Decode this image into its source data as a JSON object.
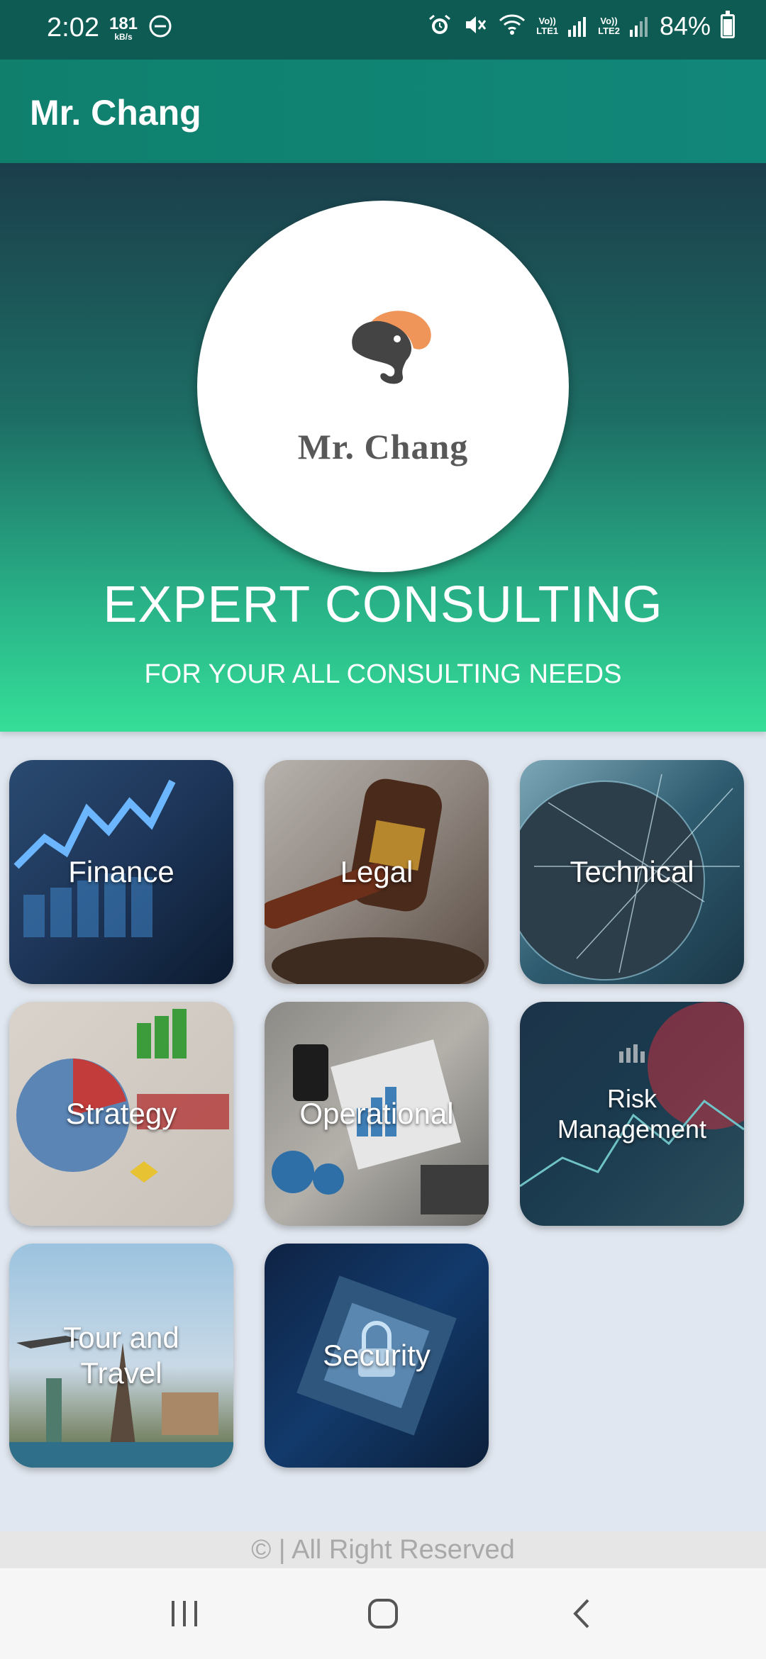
{
  "status_bar": {
    "time": "2:02",
    "speed_value": "181",
    "speed_unit": "kB/s",
    "lte1": {
      "top": "Vo))",
      "bottom": "LTE1"
    },
    "lte2": {
      "top": "Vo))",
      "bottom": "LTE2"
    },
    "battery": "84%",
    "icons": [
      "dnd-icon",
      "alarm-icon",
      "mute-icon",
      "wifi-icon",
      "signal-icon",
      "battery-icon"
    ]
  },
  "app_bar": {
    "title": "Mr. Chang"
  },
  "hero": {
    "logo_text": "Mr. Chang",
    "title": "EXPERT CONSULTING",
    "subtitle": "FOR YOUR ALL CONSULTING NEEDS"
  },
  "services": [
    {
      "label": "Finance"
    },
    {
      "label": "Legal"
    },
    {
      "label": "Technical"
    },
    {
      "label": "Strategy"
    },
    {
      "label": "Operational"
    },
    {
      "label": "Risk Management"
    },
    {
      "label": "Tour and Travel"
    },
    {
      "label": "Security"
    }
  ],
  "footer": {
    "text": "©  | All Right Reserved"
  },
  "nav_bar": {
    "icons": [
      "recents-icon",
      "home-icon",
      "back-icon"
    ]
  },
  "colors": {
    "status_bar": "#0e5b54",
    "app_bar": "#10806d",
    "hero_top": "#1b3e4b",
    "hero_bottom": "#35de98",
    "page_bg": "#e1e7f0",
    "logo_orange": "#f0955a"
  }
}
